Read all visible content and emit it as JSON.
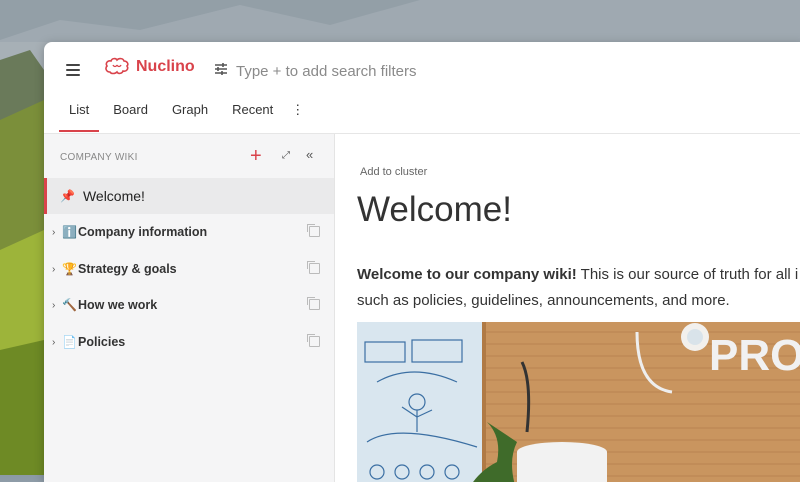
{
  "app": {
    "name": "Nuclino"
  },
  "search": {
    "placeholder": "Type + to add search filters"
  },
  "tabs": [
    {
      "label": "List",
      "active": true
    },
    {
      "label": "Board",
      "active": false
    },
    {
      "label": "Graph",
      "active": false
    },
    {
      "label": "Recent",
      "active": false
    }
  ],
  "tabs_more": "⋮",
  "sidebar": {
    "header": "COMPANY WIKI",
    "items": [
      {
        "label": "Welcome!",
        "icon": "pin-icon",
        "active": true
      },
      {
        "label": "Company information",
        "emoji": "ℹ️",
        "icon": "info-icon"
      },
      {
        "label": "Strategy & goals",
        "emoji": "🏆",
        "icon": "trophy-icon"
      },
      {
        "label": "How we work",
        "emoji": "🔨",
        "icon": "hammer-icon"
      },
      {
        "label": "Policies",
        "emoji": "📄",
        "icon": "document-icon"
      }
    ]
  },
  "main": {
    "add_cluster": "Add to cluster",
    "title": "Welcome!",
    "intro_bold": "Welcome to our company wiki!",
    "intro_rest": " This is our source of truth for all i",
    "intro_line2": "such as policies, guidelines, announcements, and more.",
    "photo_text": "PRO"
  },
  "colors": {
    "accent": "#d9434b",
    "sidebar_bg": "#f5f5f6"
  }
}
